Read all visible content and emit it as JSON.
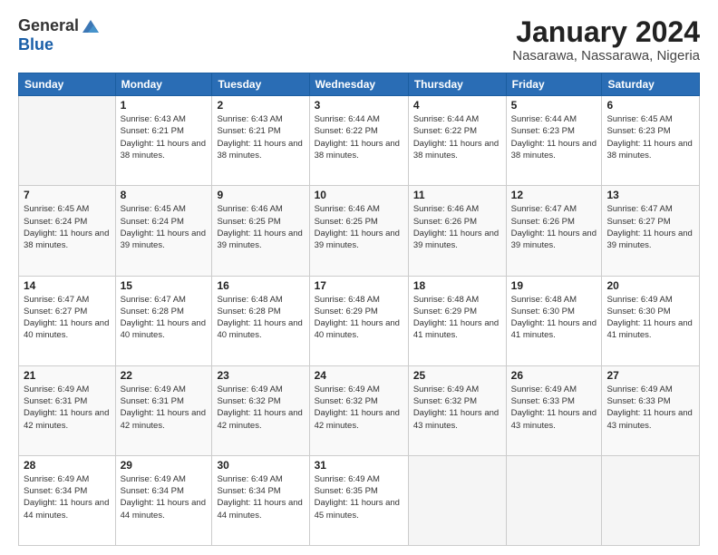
{
  "header": {
    "logo_general": "General",
    "logo_blue": "Blue",
    "month_year": "January 2024",
    "location": "Nasarawa, Nassarawa, Nigeria"
  },
  "days_of_week": [
    "Sunday",
    "Monday",
    "Tuesday",
    "Wednesday",
    "Thursday",
    "Friday",
    "Saturday"
  ],
  "weeks": [
    [
      {
        "day": "",
        "empty": true
      },
      {
        "day": "1",
        "sunrise": "Sunrise: 6:43 AM",
        "sunset": "Sunset: 6:21 PM",
        "daylight": "Daylight: 11 hours and 38 minutes."
      },
      {
        "day": "2",
        "sunrise": "Sunrise: 6:43 AM",
        "sunset": "Sunset: 6:21 PM",
        "daylight": "Daylight: 11 hours and 38 minutes."
      },
      {
        "day": "3",
        "sunrise": "Sunrise: 6:44 AM",
        "sunset": "Sunset: 6:22 PM",
        "daylight": "Daylight: 11 hours and 38 minutes."
      },
      {
        "day": "4",
        "sunrise": "Sunrise: 6:44 AM",
        "sunset": "Sunset: 6:22 PM",
        "daylight": "Daylight: 11 hours and 38 minutes."
      },
      {
        "day": "5",
        "sunrise": "Sunrise: 6:44 AM",
        "sunset": "Sunset: 6:23 PM",
        "daylight": "Daylight: 11 hours and 38 minutes."
      },
      {
        "day": "6",
        "sunrise": "Sunrise: 6:45 AM",
        "sunset": "Sunset: 6:23 PM",
        "daylight": "Daylight: 11 hours and 38 minutes."
      }
    ],
    [
      {
        "day": "7",
        "sunrise": "Sunrise: 6:45 AM",
        "sunset": "Sunset: 6:24 PM",
        "daylight": "Daylight: 11 hours and 38 minutes."
      },
      {
        "day": "8",
        "sunrise": "Sunrise: 6:45 AM",
        "sunset": "Sunset: 6:24 PM",
        "daylight": "Daylight: 11 hours and 39 minutes."
      },
      {
        "day": "9",
        "sunrise": "Sunrise: 6:46 AM",
        "sunset": "Sunset: 6:25 PM",
        "daylight": "Daylight: 11 hours and 39 minutes."
      },
      {
        "day": "10",
        "sunrise": "Sunrise: 6:46 AM",
        "sunset": "Sunset: 6:25 PM",
        "daylight": "Daylight: 11 hours and 39 minutes."
      },
      {
        "day": "11",
        "sunrise": "Sunrise: 6:46 AM",
        "sunset": "Sunset: 6:26 PM",
        "daylight": "Daylight: 11 hours and 39 minutes."
      },
      {
        "day": "12",
        "sunrise": "Sunrise: 6:47 AM",
        "sunset": "Sunset: 6:26 PM",
        "daylight": "Daylight: 11 hours and 39 minutes."
      },
      {
        "day": "13",
        "sunrise": "Sunrise: 6:47 AM",
        "sunset": "Sunset: 6:27 PM",
        "daylight": "Daylight: 11 hours and 39 minutes."
      }
    ],
    [
      {
        "day": "14",
        "sunrise": "Sunrise: 6:47 AM",
        "sunset": "Sunset: 6:27 PM",
        "daylight": "Daylight: 11 hours and 40 minutes."
      },
      {
        "day": "15",
        "sunrise": "Sunrise: 6:47 AM",
        "sunset": "Sunset: 6:28 PM",
        "daylight": "Daylight: 11 hours and 40 minutes."
      },
      {
        "day": "16",
        "sunrise": "Sunrise: 6:48 AM",
        "sunset": "Sunset: 6:28 PM",
        "daylight": "Daylight: 11 hours and 40 minutes."
      },
      {
        "day": "17",
        "sunrise": "Sunrise: 6:48 AM",
        "sunset": "Sunset: 6:29 PM",
        "daylight": "Daylight: 11 hours and 40 minutes."
      },
      {
        "day": "18",
        "sunrise": "Sunrise: 6:48 AM",
        "sunset": "Sunset: 6:29 PM",
        "daylight": "Daylight: 11 hours and 41 minutes."
      },
      {
        "day": "19",
        "sunrise": "Sunrise: 6:48 AM",
        "sunset": "Sunset: 6:30 PM",
        "daylight": "Daylight: 11 hours and 41 minutes."
      },
      {
        "day": "20",
        "sunrise": "Sunrise: 6:49 AM",
        "sunset": "Sunset: 6:30 PM",
        "daylight": "Daylight: 11 hours and 41 minutes."
      }
    ],
    [
      {
        "day": "21",
        "sunrise": "Sunrise: 6:49 AM",
        "sunset": "Sunset: 6:31 PM",
        "daylight": "Daylight: 11 hours and 42 minutes."
      },
      {
        "day": "22",
        "sunrise": "Sunrise: 6:49 AM",
        "sunset": "Sunset: 6:31 PM",
        "daylight": "Daylight: 11 hours and 42 minutes."
      },
      {
        "day": "23",
        "sunrise": "Sunrise: 6:49 AM",
        "sunset": "Sunset: 6:32 PM",
        "daylight": "Daylight: 11 hours and 42 minutes."
      },
      {
        "day": "24",
        "sunrise": "Sunrise: 6:49 AM",
        "sunset": "Sunset: 6:32 PM",
        "daylight": "Daylight: 11 hours and 42 minutes."
      },
      {
        "day": "25",
        "sunrise": "Sunrise: 6:49 AM",
        "sunset": "Sunset: 6:32 PM",
        "daylight": "Daylight: 11 hours and 43 minutes."
      },
      {
        "day": "26",
        "sunrise": "Sunrise: 6:49 AM",
        "sunset": "Sunset: 6:33 PM",
        "daylight": "Daylight: 11 hours and 43 minutes."
      },
      {
        "day": "27",
        "sunrise": "Sunrise: 6:49 AM",
        "sunset": "Sunset: 6:33 PM",
        "daylight": "Daylight: 11 hours and 43 minutes."
      }
    ],
    [
      {
        "day": "28",
        "sunrise": "Sunrise: 6:49 AM",
        "sunset": "Sunset: 6:34 PM",
        "daylight": "Daylight: 11 hours and 44 minutes."
      },
      {
        "day": "29",
        "sunrise": "Sunrise: 6:49 AM",
        "sunset": "Sunset: 6:34 PM",
        "daylight": "Daylight: 11 hours and 44 minutes."
      },
      {
        "day": "30",
        "sunrise": "Sunrise: 6:49 AM",
        "sunset": "Sunset: 6:34 PM",
        "daylight": "Daylight: 11 hours and 44 minutes."
      },
      {
        "day": "31",
        "sunrise": "Sunrise: 6:49 AM",
        "sunset": "Sunset: 6:35 PM",
        "daylight": "Daylight: 11 hours and 45 minutes."
      },
      {
        "day": "",
        "empty": true
      },
      {
        "day": "",
        "empty": true
      },
      {
        "day": "",
        "empty": true
      }
    ]
  ]
}
